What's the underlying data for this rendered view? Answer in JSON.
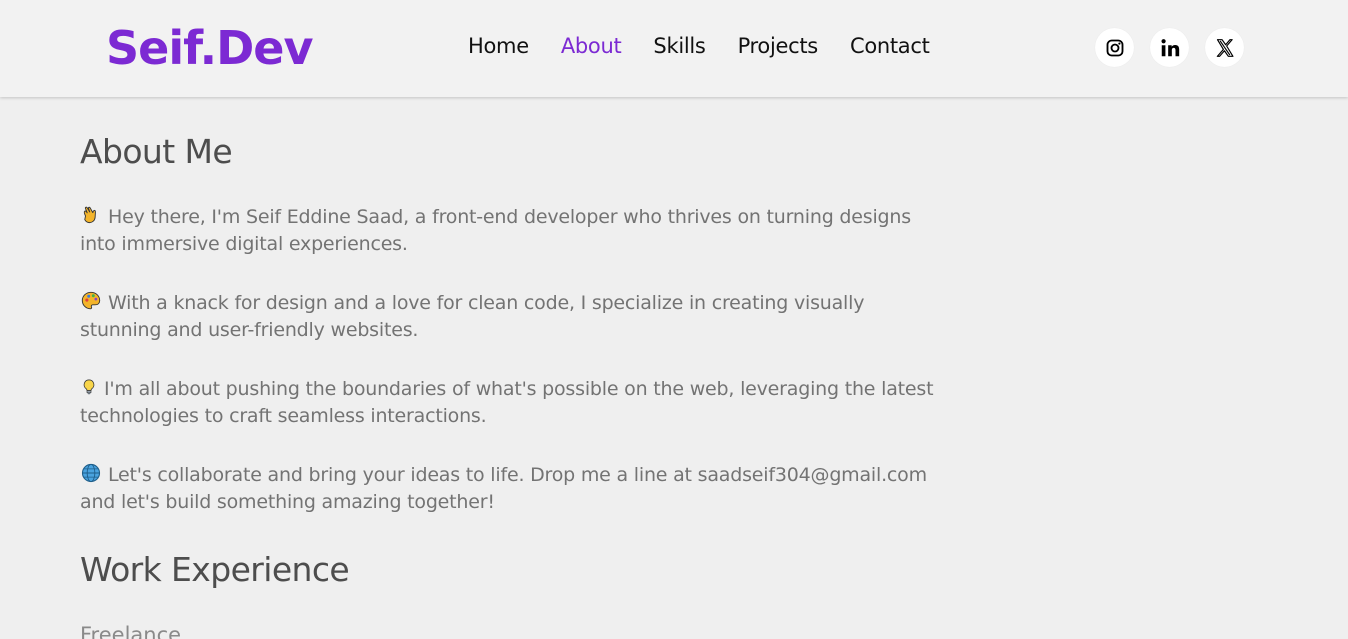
{
  "header": {
    "logo": "Seif.Dev",
    "nav": [
      {
        "label": "Home"
      },
      {
        "label": "About"
      },
      {
        "label": "Skills"
      },
      {
        "label": "Projects"
      },
      {
        "label": "Contact"
      }
    ],
    "active_nav": "About",
    "socials": [
      "instagram-icon",
      "linkedin-icon",
      "x-twitter-icon"
    ]
  },
  "about": {
    "title": "About Me",
    "paragraphs": [
      {
        "emoji": "waving-hand-icon",
        "text": "Hey there, I'm Seif Eddine Saad, a front-end developer who thrives on turning designs into immersive digital experiences."
      },
      {
        "emoji": "palette-icon",
        "text": "With a knack for design and a love for clean code, I specialize in creating visually stunning and user-friendly websites."
      },
      {
        "emoji": "light-bulb-icon",
        "text": "I'm all about pushing the boundaries of what's possible on the web, leveraging the latest technologies to craft seamless interactions."
      },
      {
        "emoji": "globe-icon",
        "text": "Let's collaborate and bring your ideas to life. Drop me a line at saadseif304@gmail.com and let's build something amazing together!"
      }
    ]
  },
  "work": {
    "title": "Work Experience",
    "items": [
      {
        "title": "Freelance"
      }
    ]
  },
  "colors": {
    "accent": "#7c2ad3",
    "background": "#efefef",
    "header_bg": "#f2f2f2",
    "heading": "#4d4d4d",
    "body_text": "#737373"
  }
}
